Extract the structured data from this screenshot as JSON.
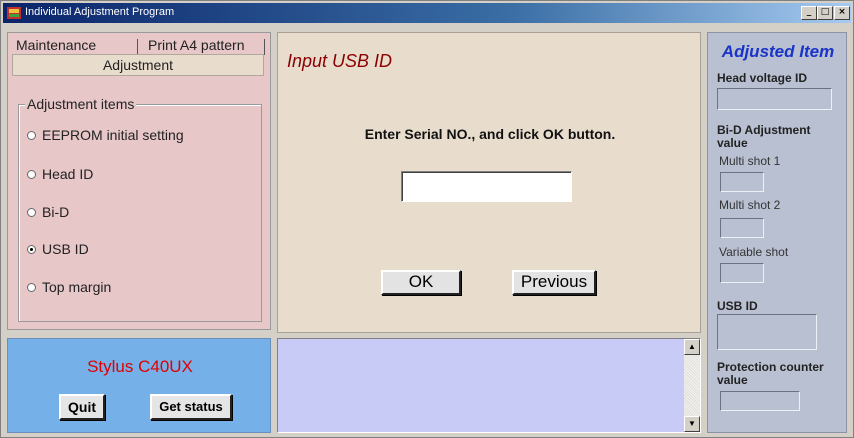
{
  "window": {
    "title": "Individual Adjustment Program"
  },
  "titlebar_buttons": {
    "minimize": "_",
    "maximize": "□",
    "close": "×"
  },
  "tabs": {
    "maintenance": "Maintenance",
    "print_a4": "Print A4 pattern",
    "adjustment": "Adjustment"
  },
  "adjustment_items": {
    "label": "Adjustment items",
    "items": [
      {
        "label": "EEPROM initial setting",
        "selected": false
      },
      {
        "label": "Head ID",
        "selected": false
      },
      {
        "label": "Bi-D",
        "selected": false
      },
      {
        "label": "USB ID",
        "selected": true
      },
      {
        "label": "Top margin",
        "selected": false
      }
    ]
  },
  "status_panel": {
    "model": "Stylus C40UX",
    "quit_label": "Quit",
    "get_status_label": "Get status"
  },
  "main": {
    "title": "Input USB ID",
    "instruction": "Enter Serial NO., and click OK button.",
    "serial_value": "",
    "ok_label": "OK",
    "previous_label": "Previous"
  },
  "adjusted": {
    "title": "Adjusted Item",
    "head_voltage_label": "Head voltage ID",
    "bid_label": "Bi-D Adjustment value",
    "multi_shot_1": "Multi shot 1",
    "multi_shot_2": "Multi shot 2",
    "variable_shot": "Variable shot",
    "usb_id_label": "USB ID",
    "protection_label": "Protection counter value"
  },
  "colors": {
    "left_panel": "#e7c7c8",
    "status_panel": "#76b0e8",
    "main_panel": "#e8dccd",
    "log_panel": "#c8cbf5",
    "right_panel": "#b9c0d2",
    "accent_title": "#1a34c8",
    "model_text": "#e00000"
  }
}
